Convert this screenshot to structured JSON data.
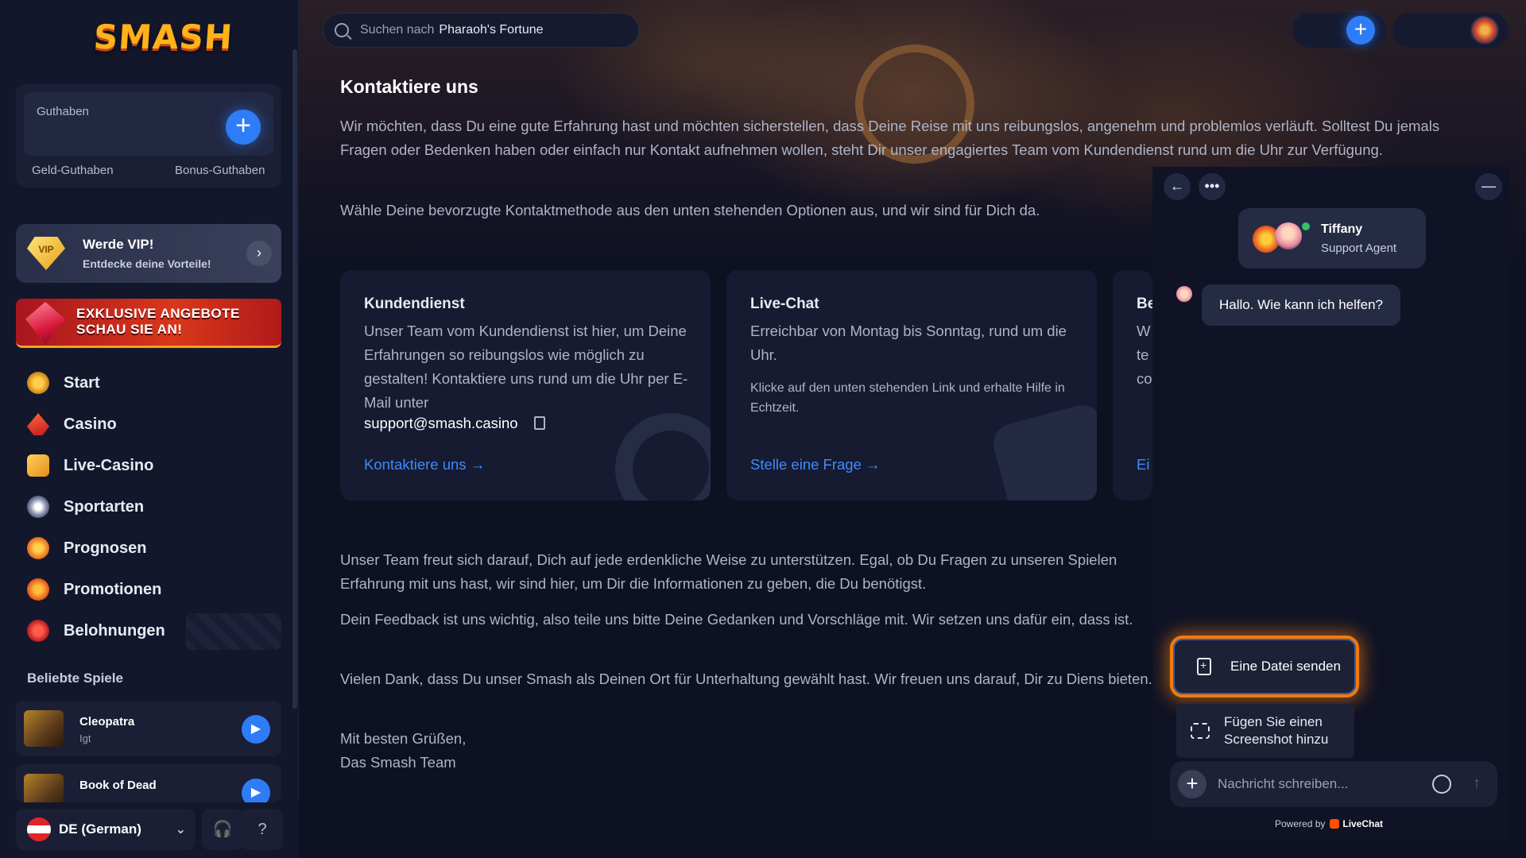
{
  "brand": {
    "logo": "SMASH"
  },
  "search": {
    "prefix": "Suchen nach",
    "query": "Pharaoh's Fortune"
  },
  "balance": {
    "label": "Guthaben",
    "money_label": "Geld-Guthaben",
    "bonus_label": "Bonus-Guthaben"
  },
  "vip": {
    "badge": "VIP",
    "title": "Werde VIP!",
    "subtitle": "Entdecke deine Vorteile!"
  },
  "offer": {
    "line1": "EXKLUSIVE ANGEBOTE",
    "line2": "SCHAU SIE AN!"
  },
  "nav": {
    "items": [
      {
        "label": "Start",
        "icon": "sun-icon"
      },
      {
        "label": "Casino",
        "icon": "spade-icon"
      },
      {
        "label": "Live-Casino",
        "icon": "dice-icon"
      },
      {
        "label": "Sportarten",
        "icon": "soccer-ball-icon"
      },
      {
        "label": "Prognosen",
        "icon": "trend-icon"
      },
      {
        "label": "Promotionen",
        "icon": "gift-icon"
      },
      {
        "label": "Belohnungen",
        "icon": "medal-icon"
      }
    ]
  },
  "popular": {
    "title": "Beliebte Spiele",
    "games": [
      {
        "name": "Cleopatra",
        "provider": "Igt"
      },
      {
        "name": "Book of Dead",
        "provider": ""
      }
    ]
  },
  "footer": {
    "language": "DE (German)"
  },
  "content": {
    "title": "Kontaktiere uns",
    "intro": "Wir möchten, dass Du eine gute Erfahrung hast und möchten sicherstellen, dass Deine Reise mit uns reibungslos, angenehm und problemlos verläuft. Solltest Du jemals Fragen oder Bedenken haben oder einfach nur Kontakt aufnehmen wollen, steht Dir unser engagiertes Team vom Kundendienst rund um die Uhr zur Verfügung.",
    "choose": "Wähle Deine bevorzugte Kontaktmethode aus den unten stehenden Optionen aus, und wir sind für Dich da.",
    "cards": [
      {
        "title": "Kundendienst",
        "text": "Unser Team vom Kundendienst ist hier, um Deine Erfahrungen so reibungslos wie möglich zu gestalten! Kontaktiere uns rund um die Uhr per E-Mail unter",
        "email": "support@smash.casino",
        "link": "Kontaktiere uns →"
      },
      {
        "title": "Live-Chat",
        "text": "Erreichbar von Montag bis Sonntag, rund um die Uhr.",
        "small": "Klicke auf den unten stehenden Link und erhalte Hilfe in Echtzeit.",
        "link": "Stelle eine Frage →"
      },
      {
        "title": "Be",
        "text": "W\nte\nco",
        "link": "Ei"
      }
    ],
    "p1": "Unser Team freut sich darauf, Dich auf jede erdenkliche Weise zu unterstützen. Egal, ob Du Fragen zu unseren Spielen Erfahrung mit uns hast, wir sind hier, um Dir die Informationen zu geben, die Du benötigst.",
    "p2": "Dein Feedback ist uns wichtig, also teile uns bitte Deine Gedanken und Vorschläge mit. Wir setzen uns dafür ein, dass ist.",
    "p3": "Vielen Dank, dass Du unser Smash als Deinen Ort für Unterhaltung gewählt hast. Wir freuen uns darauf, Dir zu Diens bieten.",
    "closing1": "Mit besten Grüßen,",
    "closing2": "Das Smash Team"
  },
  "chat": {
    "agent_name": "Tiffany",
    "agent_role": "Support Agent",
    "greeting": "Hallo. Wie kann ich helfen?",
    "send_file": "Eine Datei senden",
    "screenshot_line1": "Fügen Sie einen",
    "screenshot_line2": "Screenshot hinzu",
    "placeholder": "Nachricht schreiben...",
    "powered_by": "Powered by",
    "powered_brand": "LiveChat"
  },
  "colors": {
    "accent": "#2e7df6",
    "highlight": "#f07a0c",
    "link": "#3d8bff"
  }
}
